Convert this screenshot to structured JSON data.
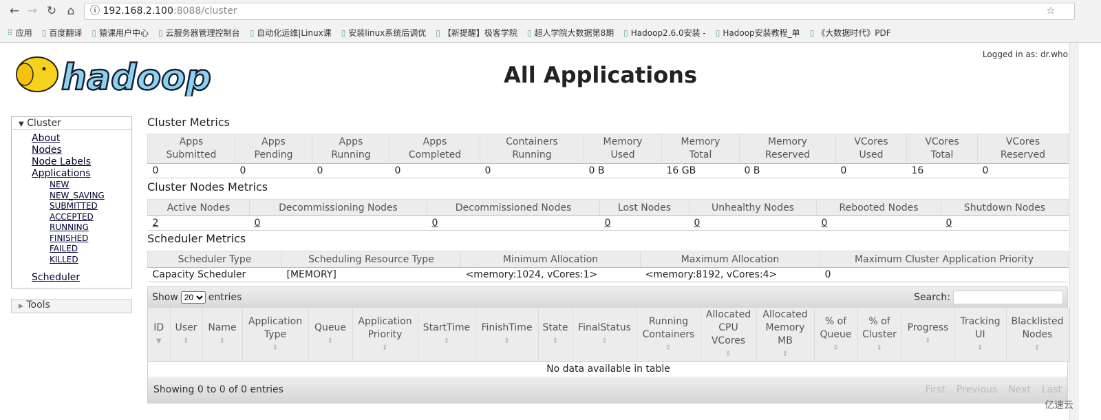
{
  "browser": {
    "url_host": "192.168.2.100",
    "url_port": ":8088",
    "url_path": "/cluster",
    "bookmarks": [
      "应用",
      "百度翻译",
      "猿课用户中心",
      "云服务器管理控制台",
      "自动化运维|Linux课",
      "安装linux系统后调优",
      "【新提醒】极客学院",
      "超人学院大数据第8期",
      "Hadoop2.6.0安装 -",
      "Hadoop安装教程_单",
      "《大数据时代》PDF"
    ]
  },
  "header": {
    "logged_in": "Logged in as: dr.who",
    "title": "All Applications",
    "logo_text": "hadoop"
  },
  "sidebar": {
    "cluster": "Cluster",
    "links": [
      "About",
      "Nodes",
      "Node Labels",
      "Applications"
    ],
    "states": [
      "NEW",
      "NEW_SAVING",
      "SUBMITTED",
      "ACCEPTED",
      "RUNNING",
      "FINISHED",
      "FAILED",
      "KILLED"
    ],
    "scheduler": "Scheduler",
    "tools": "Tools"
  },
  "cluster_metrics": {
    "title": "Cluster Metrics",
    "headers": [
      [
        "Apps",
        "Submitted"
      ],
      [
        "Apps",
        "Pending"
      ],
      [
        "Apps",
        "Running"
      ],
      [
        "Apps",
        "Completed"
      ],
      [
        "Containers",
        "Running"
      ],
      [
        "Memory",
        "Used"
      ],
      [
        "Memory",
        "Total"
      ],
      [
        "Memory",
        "Reserved"
      ],
      [
        "VCores",
        "Used"
      ],
      [
        "VCores",
        "Total"
      ],
      [
        "VCores",
        "Reserved"
      ]
    ],
    "values": [
      "0",
      "0",
      "0",
      "0",
      "0",
      "0 B",
      "16 GB",
      "0 B",
      "0",
      "16",
      "0"
    ]
  },
  "nodes_metrics": {
    "title": "Cluster Nodes Metrics",
    "headers": [
      "Active Nodes",
      "Decommissioning Nodes",
      "Decommissioned Nodes",
      "Lost Nodes",
      "Unhealthy Nodes",
      "Rebooted Nodes",
      "Shutdown Nodes"
    ],
    "values": [
      "2",
      "0",
      "0",
      "0",
      "0",
      "0",
      "0"
    ]
  },
  "scheduler_metrics": {
    "title": "Scheduler Metrics",
    "headers": [
      "Scheduler Type",
      "Scheduling Resource Type",
      "Minimum Allocation",
      "Maximum Allocation",
      "Maximum Cluster Application Priority"
    ],
    "values": [
      "Capacity Scheduler",
      "[MEMORY]",
      "<memory:1024, vCores:1>",
      "<memory:8192, vCores:4>",
      "0"
    ]
  },
  "apps_table": {
    "show": "Show",
    "entries_value": "20",
    "entries": "entries",
    "search": "Search:",
    "columns": [
      "ID",
      "User",
      "Name",
      "Application Type",
      "Queue",
      "Application Priority",
      "StartTime",
      "FinishTime",
      "State",
      "FinalStatus",
      "Running Containers",
      "Allocated CPU VCores",
      "Allocated Memory MB",
      "% of Queue",
      "% of Cluster",
      "Progress",
      "Tracking UI",
      "Blacklisted Nodes"
    ],
    "empty": "No data available in table",
    "info": "Showing 0 to 0 of 0 entries",
    "pager": [
      "First",
      "Previous",
      "Next",
      "Last"
    ]
  },
  "watermark": "亿速云"
}
